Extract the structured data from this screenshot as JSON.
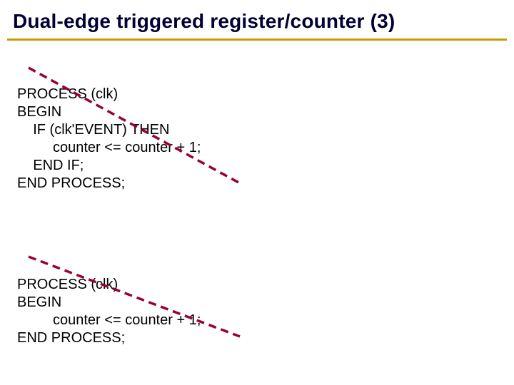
{
  "title": "Dual-edge triggered register/counter (3)",
  "code1": {
    "l1": "PROCESS (clk)",
    "l2": "BEGIN",
    "l3": "    IF (clk'EVENT) THEN",
    "l4": "         counter <= counter + 1;",
    "l5": "    END IF;",
    "l6": "END PROCESS;"
  },
  "code2": {
    "l1": "PROCESS (clk)",
    "l2": "BEGIN",
    "l3": "         counter <= counter + 1;",
    "l4": "END PROCESS;"
  }
}
